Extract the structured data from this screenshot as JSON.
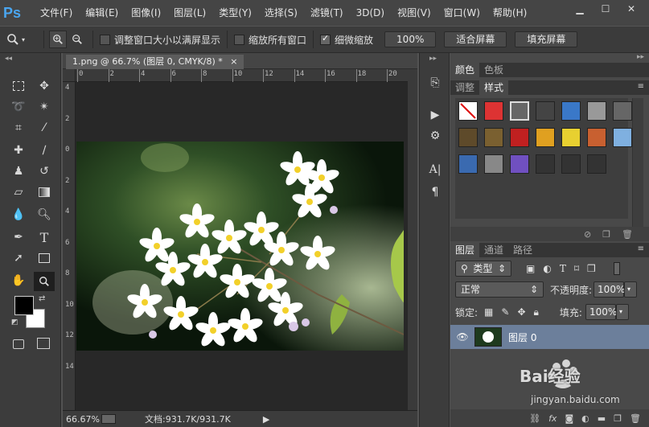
{
  "app": {
    "logo_text": "Ps"
  },
  "menu": [
    "文件(F)",
    "编辑(E)",
    "图像(I)",
    "图层(L)",
    "类型(Y)",
    "选择(S)",
    "滤镜(T)",
    "3D(D)",
    "视图(V)",
    "窗口(W)",
    "帮助(H)"
  ],
  "window_controls": {
    "minimize": "▁",
    "maximize": "☐",
    "close": "✕"
  },
  "options": {
    "resize_windows_label": "调整窗口大小以满屏显示",
    "zoom_all_windows_label": "缩放所有窗口",
    "scrubby_zoom_label": "细微缩放",
    "zoom_percent_button": "100%",
    "fit_screen_button": "适合屏幕",
    "fill_screen_button": "填充屏幕"
  },
  "document": {
    "tab_title": "1.png @ 66.7% (图层 0, CMYK/8) *",
    "tab_close": "×",
    "ruler_top_ticks": [
      "0",
      "2",
      "4",
      "6",
      "8",
      "10",
      "12",
      "14",
      "16",
      "18",
      "20"
    ],
    "ruler_left_ticks": [
      "4",
      "2",
      "0",
      "2",
      "4",
      "6",
      "8",
      "10",
      "12",
      "14"
    ],
    "zoom_level": "66.67%",
    "doc_size": "文档:931.7K/931.7K"
  },
  "panels": {
    "color_tab": "颜色",
    "swatches_tab": "色板",
    "adjustments_tab": "调整",
    "styles_tab": "样式",
    "layers_tab": "图层",
    "channels_tab": "通道",
    "paths_tab": "路径"
  },
  "layers": {
    "filter_kind": "类型",
    "blend_mode": "正常",
    "opacity_label": "不透明度:",
    "opacity_value": "100%",
    "lock_label": "锁定:",
    "fill_label": "填充:",
    "fill_value": "100%",
    "layer_name": "图层 0"
  },
  "watermark": {
    "brand": "Bai经验",
    "url": "jingyan.baidu.com"
  },
  "colors": {
    "accent": "#4aa6f0",
    "selected_layer": "#6c7f9b"
  }
}
